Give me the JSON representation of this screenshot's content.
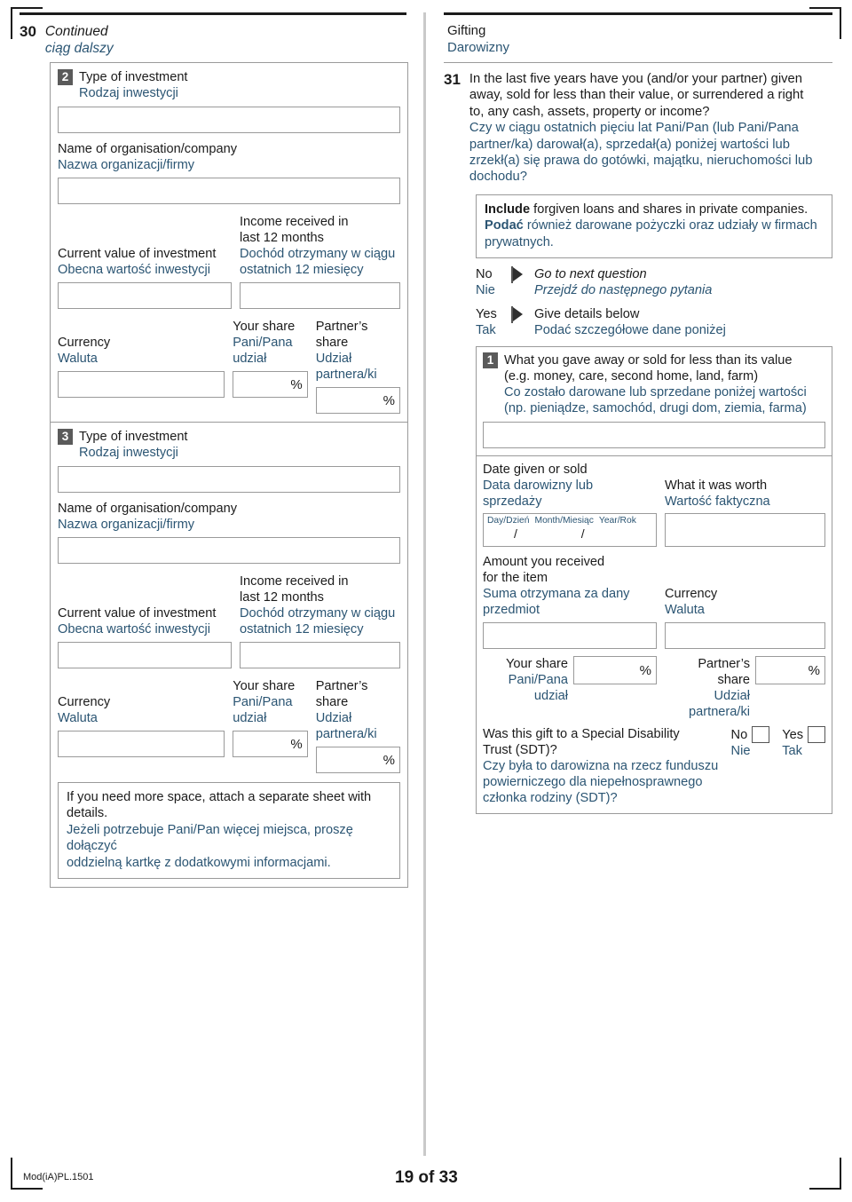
{
  "document": {
    "footer_code": "Mod(iA)PL.1501",
    "page_label": "19 of 33"
  },
  "left_column": {
    "question_number": "30",
    "continued_en": "Continued",
    "continued_pl": "ciąg dalszy",
    "common": {
      "type_of_investment_en": "Type of investment",
      "type_of_investment_pl": "Rodzaj inwestycji",
      "org_name_en": "Name of organisation/company",
      "org_name_pl": "Nazwa organizacji/firmy",
      "current_value_en": "Current value of investment",
      "current_value_pl": "Obecna wartość inwestycji",
      "income_en_line1": "Income received in",
      "income_en_line2": "last 12 months",
      "income_pl_line1": "Dochód otrzymany w ciągu",
      "income_pl_line2": "ostatnich 12 miesięcy",
      "currency_en": "Currency",
      "currency_pl": "Waluta",
      "your_share_en": "Your share",
      "your_share_pl_line1": "Pani/Pana",
      "your_share_pl_line2": "udział",
      "partner_share_en": "Partner’s share",
      "partner_share_pl_line1": "Udział",
      "partner_share_pl_line2": "partnera/ki",
      "percent_symbol": "%"
    },
    "item2_badge": "2",
    "item3_badge": "3",
    "more_space_en": "If you need more space, attach a separate sheet with details.",
    "more_space_pl_line1": "Jeżeli potrzebuje Pani/Pan więcej miejsca, proszę dołączyć",
    "more_space_pl_line2": "oddzielną kartkę z dodatkowymi informacjami."
  },
  "right_column": {
    "section_title_en": "Gifting",
    "section_title_pl": "Darowizny",
    "question_number": "31",
    "question_en_line1": "In the last five years have you (and/or your partner) given",
    "question_en_line2": "away, sold for less than their value, or surrendered a right",
    "question_en_line3": "to, any cash, assets, property or income?",
    "question_pl_line1": "Czy w ciągu ostatnich pięciu lat Pani/Pan (lub Pani/Pana",
    "question_pl_line2": "partner/ka) darował(a), sprzedał(a) poniżej wartości lub",
    "question_pl_line3": "zrzekł(a) się prawa do gotówki, majątku, nieruchomości lub",
    "question_pl_line4": "dochodu?",
    "note_en_bold": "Include",
    "note_en_rest": " forgiven loans and shares in private companies.",
    "note_pl_bold": "Podać",
    "note_pl_rest": " również darowane pożyczki oraz udziały w firmach",
    "note_pl_line2": "prywatnych.",
    "answer_no_en": "No",
    "answer_no_pl": "Nie",
    "answer_no_action_en": "Go to next question",
    "answer_no_action_pl": "Przejdź do następnego pytania",
    "answer_yes_en": "Yes",
    "answer_yes_pl": "Tak",
    "answer_yes_action_en": "Give details below",
    "answer_yes_action_pl": "Podać szczegółowe dane poniżej",
    "item1_badge": "1",
    "gave_away_en_line1": "What you gave away or sold for less than its value",
    "gave_away_en_line2": "(e.g. money, care, second home, land, farm)",
    "gave_away_pl_line1": "Co zostało darowane lub sprzedane poniżej wartości",
    "gave_away_pl_line2": "(np. pieniądze, samochód, drugi dom, ziemia, farma)",
    "date_given_en": "Date given or sold",
    "date_given_pl_line1": "Data darowizny lub",
    "date_given_pl_line2": "sprzedaży",
    "date_day": "Day/Dzień",
    "date_month": "Month/Miesiąc",
    "date_year": "Year/Rok",
    "worth_en": "What it was worth",
    "worth_pl": "Wartość faktyczna",
    "amount_en_line1": "Amount you received",
    "amount_en_line2": "for the item",
    "amount_pl_line1": "Suma otrzymana za dany",
    "amount_pl_line2": "przedmiot",
    "currency_en": "Currency",
    "currency_pl": "Waluta",
    "your_share_en": "Your share",
    "your_share_pl_line1": "Pani/Pana",
    "your_share_pl_line2": "udział",
    "partner_share_en": "Partner’s share",
    "partner_share_pl_line1": "Udział",
    "partner_share_pl_line2": "partnera/ki",
    "percent_symbol": "%",
    "sdt_en_line1": "Was this gift to a Special Disability",
    "sdt_en_line2": "Trust (SDT)?",
    "sdt_pl_line1": "Czy była to darowizna na rzecz funduszu",
    "sdt_pl_line2": "powierniczego dla niepełnosprawnego",
    "sdt_pl_line3": "członka rodziny (SDT)?",
    "sdt_no_en": "No",
    "sdt_no_pl": "Nie",
    "sdt_yes_en": "Yes",
    "sdt_yes_pl": "Tak"
  },
  "colors": {
    "polish_text": "#2b5573",
    "english_text": "#1b1b1b",
    "badge_bg": "#5a5a5a",
    "field_border": "#9a9a9a"
  }
}
